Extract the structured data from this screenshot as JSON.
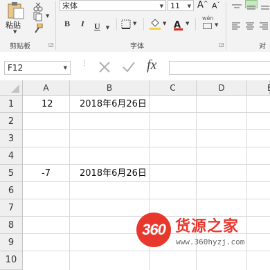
{
  "ribbon": {
    "clipboard": {
      "paste_label": "粘贴",
      "group_label": "剪贴板"
    },
    "font": {
      "font_name": "宋体",
      "font_size": "11",
      "group_label": "字体",
      "bold": "B",
      "italic": "I",
      "underline": "U",
      "grow_font": "A",
      "shrink_font": "A",
      "phonetic": "wén",
      "font_color": "A"
    },
    "alignment": {
      "group_label": "对"
    }
  },
  "formula_bar": {
    "name_box": "F12",
    "fx_label": "fx",
    "formula": ""
  },
  "sheet": {
    "columns": [
      "A",
      "B",
      "C",
      "D",
      "E"
    ],
    "rows": [
      "1",
      "2",
      "3",
      "4",
      "5",
      "6",
      "7",
      "8",
      "9",
      "10"
    ],
    "cells": {
      "A1": "12",
      "B1": "2018年6月26日",
      "A5": "-7",
      "B5": "2018年6月26日"
    }
  },
  "watermark": {
    "badge": "360",
    "title": "货源之家",
    "url": "www.360hyzj.com"
  },
  "colors": {
    "ribbon_bg": "#f3f3f3",
    "header_bg": "#efefef",
    "gridline": "#dadada",
    "font_color_accent": "#d9241c",
    "highlight_accent": "#f6d23c",
    "watermark_red": "#e8382e"
  }
}
